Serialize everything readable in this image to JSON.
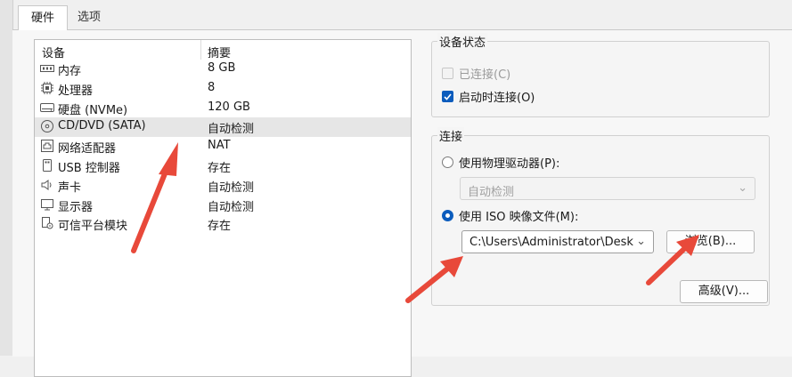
{
  "tabs": [
    {
      "label": "硬件"
    },
    {
      "label": "选项"
    }
  ],
  "device_list": {
    "headers": {
      "device": "设备",
      "summary": "摘要"
    },
    "rows": [
      {
        "icon": "memory-icon",
        "name": "内存",
        "summary": "8 GB"
      },
      {
        "icon": "processor-icon",
        "name": "处理器",
        "summary": "8"
      },
      {
        "icon": "disk-icon",
        "name": "硬盘 (NVMe)",
        "summary": "120 GB"
      },
      {
        "icon": "cd-dvd-icon",
        "name": "CD/DVD (SATA)",
        "summary": "自动检测"
      },
      {
        "icon": "network-adapter-icon",
        "name": "网络适配器",
        "summary": "NAT"
      },
      {
        "icon": "usb-icon",
        "name": "USB 控制器",
        "summary": "存在"
      },
      {
        "icon": "sound-card-icon",
        "name": "声卡",
        "summary": "自动检测"
      },
      {
        "icon": "display-icon",
        "name": "显示器",
        "summary": "自动检测"
      },
      {
        "icon": "trusted-platform-icon",
        "name": "可信平台模块",
        "summary": "存在"
      }
    ]
  },
  "device_status": {
    "title": "设备状态",
    "connected_label": "已连接(C)",
    "connected_checked": false,
    "connect_at_power_on_label": "启动时连接(O)",
    "connect_at_power_on_checked": true
  },
  "connection": {
    "title": "连接",
    "physical_drive_label": "使用物理驱动器(P):",
    "physical_drive_value": "自动检测",
    "iso_label": "使用 ISO 映像文件(M):",
    "iso_path": "C:\\Users\\Administrator\\Desk",
    "browse_label": "浏览(B)...",
    "selected_option": "iso"
  },
  "advanced_label": "高级(V)...",
  "colors": {
    "accent": "#0b5cbd",
    "annotation_arrow": "#e8493a"
  }
}
